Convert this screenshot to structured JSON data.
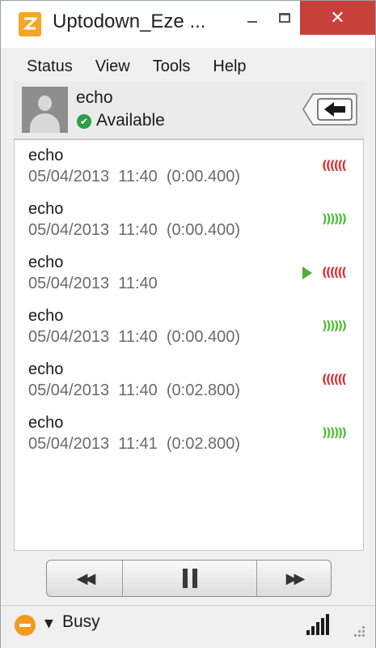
{
  "window": {
    "title": "Uptodown_Eze ..."
  },
  "menu": [
    "Status",
    "View",
    "Tools",
    "Help"
  ],
  "contact": {
    "name": "echo",
    "status": "Available"
  },
  "calls": [
    {
      "name": "echo",
      "detail": "05/04/2013  11:40  (0:00.400)",
      "direction": "incoming",
      "playing": false
    },
    {
      "name": "echo",
      "detail": "05/04/2013  11:40  (0:00.400)",
      "direction": "outgoing",
      "playing": false
    },
    {
      "name": "echo",
      "detail": "05/04/2013  11:40",
      "direction": "incoming",
      "playing": true
    },
    {
      "name": "echo",
      "detail": "05/04/2013  11:40  (0:00.400)",
      "direction": "outgoing",
      "playing": false
    },
    {
      "name": "echo",
      "detail": "05/04/2013  11:40  (0:02.800)",
      "direction": "incoming",
      "playing": false
    },
    {
      "name": "echo",
      "detail": "05/04/2013  11:41  (0:02.800)",
      "direction": "outgoing",
      "playing": false
    }
  ],
  "controls": {
    "rewind_icon": "rewind-icon",
    "pause_icon": "pause-icon",
    "forward_icon": "fast-forward-icon"
  },
  "statusbar": {
    "presence": "Busy"
  },
  "colors": {
    "close": "#c7403a",
    "available": "#2e9e47",
    "incoming": "#d93232",
    "outgoing": "#4fbf3a",
    "busy": "#f29b1d"
  }
}
